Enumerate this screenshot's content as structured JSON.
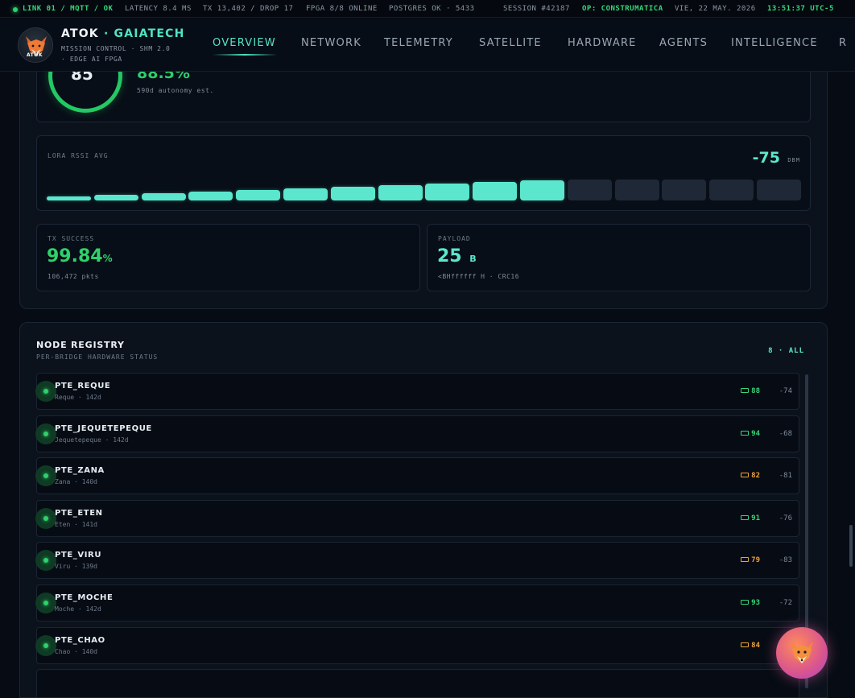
{
  "status_bar": {
    "link": "LINK 01 / MQTT / OK",
    "latency": "LATENCY 8.4 MS",
    "tx": "TX 13,402 / DROP 17",
    "fpga": "FPGA 8/8 ONLINE",
    "postgres": "POSTGRES OK · 5433",
    "session": "SESSION #42187",
    "operator": "OP: CONSTRUMATICA",
    "date": "VIE, 22 MAY. 2026",
    "time": "13:51:37 UTC-5"
  },
  "brand": {
    "name": "ATOK",
    "dot": "·",
    "name_accent": "GAIATECH",
    "sub_line1": "MISSION CONTROL · SHM 2.0",
    "sub_line2": "· EDGE AI FPGA",
    "logo_text": "ATOK"
  },
  "nav": {
    "items": [
      "OVERVIEW",
      "NETWORK",
      "TELEMETRY",
      "SATELLITE",
      "HARDWARE",
      "AGENTS",
      "INTELLIGENCE",
      "R"
    ],
    "active": "OVERVIEW"
  },
  "battery_card": {
    "gauge_value": "85",
    "percent": "88.5%",
    "autonomy": "590d autonomy est."
  },
  "rssi_card": {
    "label": "LORA RSSI AVG",
    "value": "-75",
    "unit": "DBM",
    "bars_total": 16,
    "bars_active": 11,
    "colors": {
      "active": "#5be7cd",
      "inactive": "#1e2836"
    }
  },
  "tx_card": {
    "label": "TX SUCCESS",
    "value": "99.84",
    "unit": "%",
    "sub": "106,472 pkts"
  },
  "payload_card": {
    "label": "PAYLOAD",
    "value": "25",
    "unit": "B",
    "sub": "<BHffffff H · CRC16"
  },
  "registry": {
    "title": "NODE REGISTRY",
    "subtitle": "PER-BRIDGE HARDWARE STATUS",
    "count": "8 · ALL",
    "nodes": [
      {
        "name": "PTE_REQUE",
        "sub": "Reque · 142d",
        "battery": "88",
        "rssi": "-74",
        "battery_state": "green"
      },
      {
        "name": "PTE_JEQUETEPEQUE",
        "sub": "Jequetepeque · 142d",
        "battery": "94",
        "rssi": "-68",
        "battery_state": "green"
      },
      {
        "name": "PTE_ZANA",
        "sub": "Zana · 140d",
        "battery": "82",
        "rssi": "-81",
        "battery_state": "orange"
      },
      {
        "name": "PTE_ETEN",
        "sub": "Eten · 141d",
        "battery": "91",
        "rssi": "-76",
        "battery_state": "green"
      },
      {
        "name": "PTE_VIRU",
        "sub": "Viru · 139d",
        "battery": "79",
        "rssi": "-83",
        "battery_state": "orange"
      },
      {
        "name": "PTE_MOCHE",
        "sub": "Moche · 142d",
        "battery": "93",
        "rssi": "-72",
        "battery_state": "green"
      },
      {
        "name": "PTE_CHAO",
        "sub": "Chao · 140d",
        "battery": "84",
        "rssi": "",
        "battery_state": "orange"
      }
    ]
  },
  "fab": {
    "icon": "fox-icon"
  }
}
